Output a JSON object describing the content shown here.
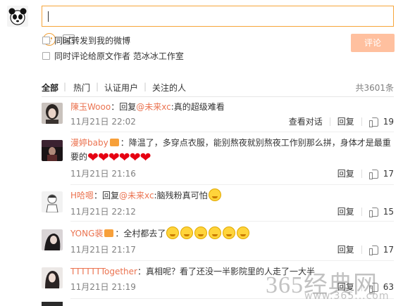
{
  "composer": {
    "input_value": "",
    "emoji_icon": "smile-icon",
    "image_icon": "picture-icon",
    "option_repost": "同时转发到我的微博",
    "option_comment_author": "同时评论给原文作者 范冰冰工作室",
    "submit_label": "评论"
  },
  "filters": {
    "all": "全部",
    "hot": "热门",
    "verified": "认证用户",
    "following": "关注的人",
    "sep": "|",
    "total": "共3601条"
  },
  "comments": [
    {
      "user": "陳玉Wooo",
      "prefix": "：回复",
      "mention": "@未来xc",
      "text": ":真的超级难看",
      "time": "11月21日 22:02",
      "view_convo": "查看对话",
      "reply": "回复",
      "likes": "19"
    },
    {
      "user": "漫婷baby",
      "text": "：降温了，多穿点衣服，能别熬夜就别熬夜工作别那么拼，身体才是最重",
      "text2": "要的",
      "time": "11月21日 21:16",
      "reply": "回复",
      "likes": "17"
    },
    {
      "user": "H哈嗯",
      "prefix": "：回复",
      "mention": "@未来xc",
      "text": ":脑残粉真可怕",
      "time": "11月21日 22:12",
      "reply": "回复",
      "likes": "15"
    },
    {
      "user": "YONG裴",
      "text": "：全村都去了",
      "time": "11月21日 21:17",
      "reply": "回复",
      "likes": "17"
    },
    {
      "user": "TTTTTTTogether",
      "text": "：真相呢？看了还没一半影院里的人走了一大半",
      "time": "11月21日 21:19",
      "reply": "回复",
      "likes": "63"
    }
  ],
  "watermark": {
    "main": "365经典网",
    "sub": "www.365...com"
  },
  "colors": {
    "accent": "#eb7350",
    "input_border": "#f6a53a",
    "submit_bg": "#ffc09f",
    "muted": "#808080"
  }
}
